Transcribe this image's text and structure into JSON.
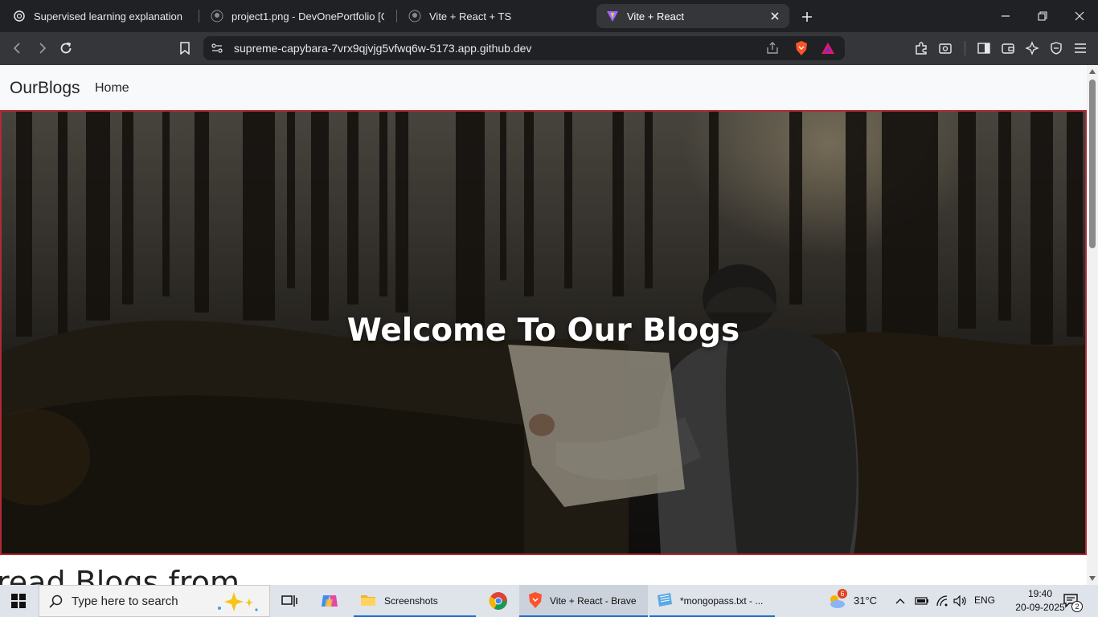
{
  "browser": {
    "tabs": [
      {
        "title": "Supervised learning explanation",
        "icon": "openai-icon",
        "active": false
      },
      {
        "title": "project1.png - DevOnePortfolio [Cod",
        "icon": "github-icon",
        "active": false
      },
      {
        "title": "Vite + React + TS",
        "icon": "github-icon",
        "active": false
      },
      {
        "title": "Vite + React",
        "icon": "vite-icon",
        "active": true
      }
    ],
    "url": "supreme-capybara-7vrx9qjvjg5vfwq6w-5173.app.github.dev"
  },
  "site": {
    "brand": "OurBlogs",
    "nav_home": "Home",
    "hero_title": "Welcome To Our Blogs",
    "section_heading": "read Blogs from"
  },
  "taskbar": {
    "search_placeholder": "Type here to search",
    "apps": [
      {
        "label": "Screenshots",
        "icon": "folder-icon"
      },
      {
        "label": "Vite + React - Brave",
        "icon": "brave-icon"
      },
      {
        "label": "*mongopass.txt - ...",
        "icon": "notepad-icon"
      }
    ],
    "weather_temp": "31°C",
    "weather_badge": "6",
    "language": "ENG",
    "time": "19:40",
    "date": "20-09-2025",
    "notifications": "2"
  },
  "colors": {
    "hero_border": "#b02a37",
    "navbar_bg": "#f8f9fa",
    "browser_dark": "#202124",
    "toolbar": "#35363a"
  }
}
